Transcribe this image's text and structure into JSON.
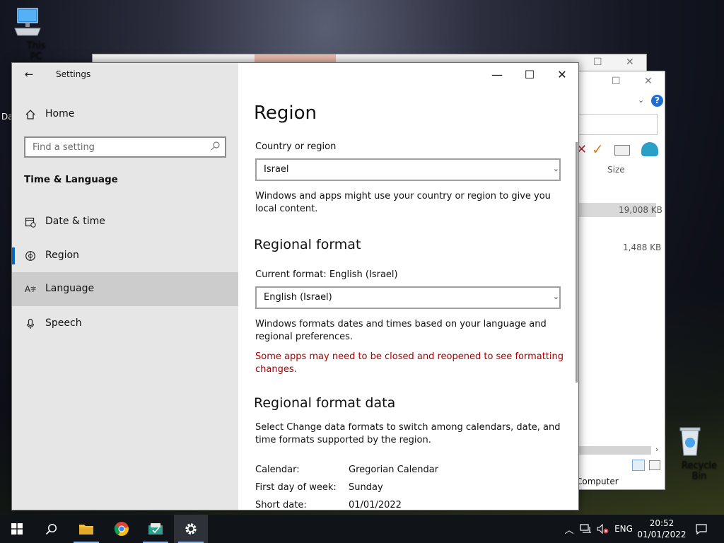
{
  "desktop": {
    "this_pc_label": "This PC",
    "recycle_bin_label": "Recycle Bin",
    "partial_label": "Da"
  },
  "explorer": {
    "size_header": "Size",
    "file1_size": "19,008 KB",
    "file2_size": "1,488 KB",
    "status_text": "Computer"
  },
  "settings": {
    "window_title": "Settings",
    "home_label": "Home",
    "search_placeholder": "Find a setting",
    "section_title": "Time & Language",
    "nav": [
      {
        "label": "Date & time"
      },
      {
        "label": "Region"
      },
      {
        "label": "Language"
      },
      {
        "label": "Speech"
      }
    ],
    "selected_nav": "Region",
    "hovered_nav": "Language"
  },
  "region": {
    "page_title": "Region",
    "country_label": "Country or region",
    "country_value": "Israel",
    "country_desc": "Windows and apps might use your country or region to give you local content.",
    "regional_format_title": "Regional format",
    "current_format_label": "Current format: English (Israel)",
    "format_value": "English (Israel)",
    "format_desc": "Windows formats dates and times based on your language and regional preferences.",
    "warning": "Some apps may need to be closed and reopened to see formatting changes.",
    "format_data_title": "Regional format data",
    "format_data_desc": "Select Change data formats to switch among calendars, date, and time formats supported by the region.",
    "rows": [
      {
        "key": "Calendar:",
        "value": "Gregorian Calendar"
      },
      {
        "key": "First day of week:",
        "value": "Sunday"
      },
      {
        "key": "Short date:",
        "value": "01/01/2022"
      }
    ]
  },
  "taskbar": {
    "language": "ENG",
    "time": "20:52",
    "date": "01/01/2022"
  },
  "colors": {
    "accent": "#0067c0",
    "warning": "#a80000",
    "sidebar_bg": "#e6e6e6",
    "taskbar_bg": "#101418"
  }
}
